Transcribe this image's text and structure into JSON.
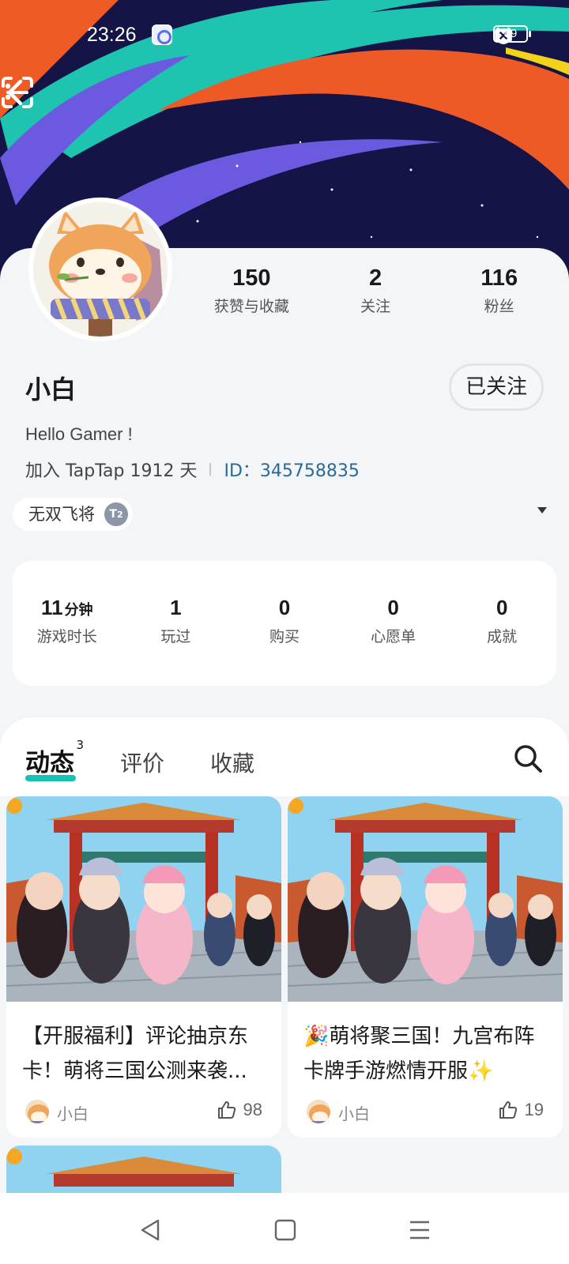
{
  "status_bar": {
    "time": "23:26",
    "battery": "89",
    "icons": [
      "app-icon",
      "alarm-icon",
      "wifi-icon",
      "mute-icon",
      "battery-icon"
    ]
  },
  "nav": {
    "icons": [
      "back-icon",
      "scan-icon",
      "more-icon"
    ]
  },
  "profile": {
    "stats": [
      {
        "value": "150",
        "label": "获赞与收藏"
      },
      {
        "value": "2",
        "label": "关注"
      },
      {
        "value": "116",
        "label": "粉丝"
      }
    ],
    "username": "小白",
    "follow_button": "已关注",
    "bio": "Hello Gamer !",
    "joined": "加入 TapTap 1912 天",
    "id_label": "ID：",
    "id_value": "345758835",
    "badge": {
      "label": "无双飞将",
      "level": "2"
    }
  },
  "game_stats": [
    {
      "value": "11",
      "unit": "分钟",
      "label": "游戏时长"
    },
    {
      "value": "1",
      "unit": "",
      "label": "玩过"
    },
    {
      "value": "0",
      "unit": "",
      "label": "购买"
    },
    {
      "value": "0",
      "unit": "",
      "label": "心愿单"
    },
    {
      "value": "0",
      "unit": "",
      "label": "成就"
    }
  ],
  "tabs": [
    {
      "label": "动态",
      "count": "3",
      "active": true
    },
    {
      "label": "评价",
      "count": "",
      "active": false
    },
    {
      "label": "收藏",
      "count": "",
      "active": false
    }
  ],
  "posts": [
    {
      "title": "【开服福利】评论抽京东卡！萌将三国公测来袭...",
      "author": "小白",
      "likes": "98"
    },
    {
      "title": "🎉萌将聚三国！九宫布阵卡牌手游燃情开服✨",
      "author": "小白",
      "likes": "19"
    }
  ],
  "colors": {
    "accent": "#17c1b4",
    "banner_bg": "#141446",
    "id_link": "#2a6a9a"
  }
}
